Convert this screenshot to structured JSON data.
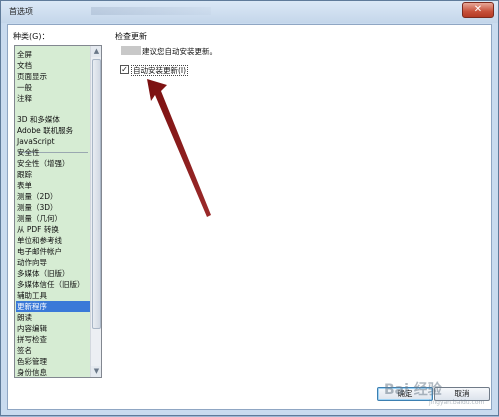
{
  "window": {
    "title": "首选项",
    "close_glyph": "✕"
  },
  "categories": {
    "label": "种类(G)：",
    "group1": [
      "全屏",
      "文档",
      "页面显示",
      "一般",
      "注释"
    ],
    "group2": [
      "3D 和多媒体",
      "Adobe 联机服务",
      "JavaScript",
      "安全性",
      "安全性（增强）",
      "跟踪",
      "表单",
      "测量（2D）",
      "测量（3D）",
      "测量（几何）",
      "从 PDF 转换",
      "单位和参考线",
      "电子邮件帐户",
      "动作向导",
      "多媒体（旧版）",
      "多媒体信任（旧版）",
      "辅助工具",
      "更新程序",
      "朗读",
      "内容编辑",
      "拼写检查",
      "签名",
      "色彩管理",
      "身份信息"
    ],
    "selected": "更新程序",
    "scroll_up_icon": "▲",
    "scroll_down_icon": "▼"
  },
  "panel": {
    "section_title": "检查更新",
    "hint_text": "建议您自动安装更新。",
    "checkbox_label": "自动安装更新(I)",
    "checkbox_checked": true,
    "check_glyph": "✓"
  },
  "buttons": {
    "ok": "确定",
    "cancel": "取消"
  },
  "watermark": {
    "text": "Bai 经验",
    "sub": "jingyan.baidu.com"
  },
  "colors": {
    "list_background": "#d6ecd3",
    "selection": "#3a79d8",
    "arrow": "#8b1a1a"
  }
}
